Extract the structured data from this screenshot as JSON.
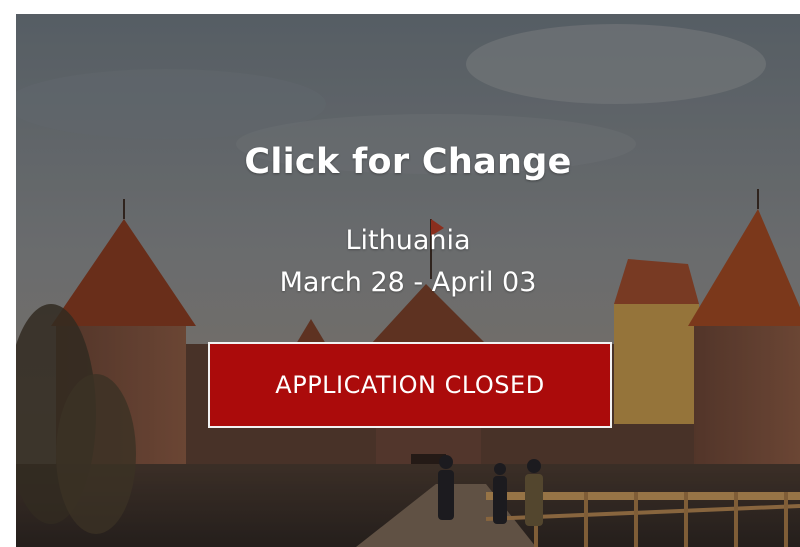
{
  "card": {
    "title": "Click for Change",
    "location": "Lithuania",
    "dates": "March 28 - April 03",
    "status_button": "APPLICATION CLOSED"
  },
  "background_image": "Trakai Island Castle at dusk with visitors on a wooden footbridge",
  "colors": {
    "button_background": "#ab0b0b",
    "button_border": "#f2f2f2",
    "text": "#ffffff"
  }
}
